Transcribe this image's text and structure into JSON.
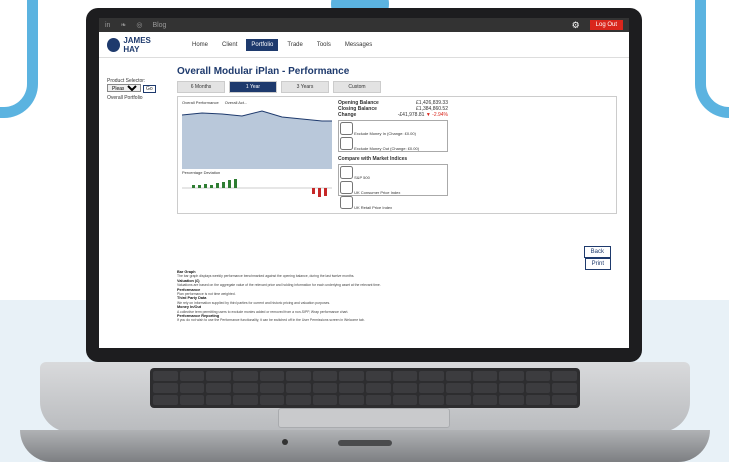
{
  "topbar": {
    "links": [
      "in",
      "❧",
      "◎",
      "Blog"
    ],
    "logout": "Log Out"
  },
  "logo": "JAMES HAY",
  "nav": [
    "Home",
    "Client",
    "Portfolio",
    "Trade",
    "Tools",
    "Messages"
  ],
  "product": {
    "label": "Product Selector:",
    "select": "Please select",
    "go": "Go",
    "item": "Overall Portfolio"
  },
  "page_title": "Overall Modular iPlan - Performance",
  "period_tabs": [
    "6 Months",
    "1 Year",
    "3 Years",
    "Custom"
  ],
  "legend": [
    "Overall Performance",
    "Overall Act..."
  ],
  "lower_legend": "Percentage Deviation",
  "summary": {
    "opening": {
      "label": "Opening Balance",
      "value": "£1,426,839.33"
    },
    "closing": {
      "label": "Closing Balance",
      "value": "£1,384,860.52"
    },
    "change": {
      "label": "Change",
      "value": "-£41,978.81",
      "pct": "-2.94%"
    }
  },
  "options": [
    "Exclude Money In (Change: £0.00)",
    "Exclude Money Out (Change: £0.00)"
  ],
  "compare": {
    "title": "Compare with Market Indices",
    "items": [
      "S&P 500",
      "UK Consumer Price Index",
      "UK Retail Price Index"
    ]
  },
  "buttons": {
    "back": "Back",
    "print": "Print"
  },
  "notes": [
    {
      "title": "Bar Graph",
      "text": "The bar graph displays weekly performance benchmarked against the opening balance, during the last twelve months."
    },
    {
      "title": "Valuation (£)",
      "text": "Valuations are based on the aggregate value of the relevant price and holding information for each underlying asset at the relevant time."
    },
    {
      "title": "Performance",
      "text": "Plan performance is not time weighted."
    },
    {
      "title": "Third Party Data",
      "text": "We rely on information supplied by third parties for current and historic pricing and valuation purposes."
    },
    {
      "title": "Money In/Out",
      "text": "A collective term permitting users to exclude monies added or removed from a non-SIPP, Wrap performance chart."
    },
    {
      "title": "Performance Reporting",
      "text": "If you do not wish to use the Performance functionality, it can be switched off in the User Permissions screen in Welcome tab."
    }
  ]
}
